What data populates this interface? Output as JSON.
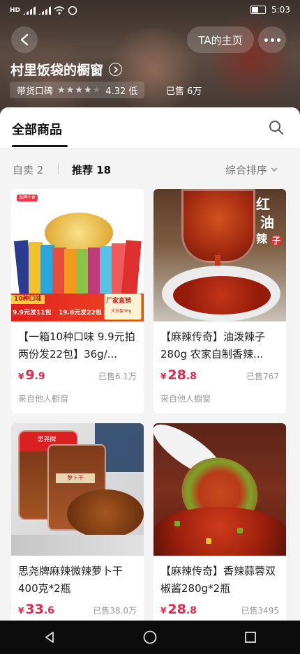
{
  "status_bar": {
    "time": "5:03"
  },
  "header": {
    "back_icon": "chevron-left-icon",
    "ta_home_label": "TA的主页",
    "more_icon": "more-dots-icon",
    "shop_name": "村里饭袋的橱窗",
    "rating_label": "带货口碑",
    "rating_stars": 4,
    "rating_value": "4.32 低",
    "sold_total": "已售 6万"
  },
  "tabs": {
    "all_products": "全部商品"
  },
  "filters": {
    "self_sell": "自卖 2",
    "recommended": "推荐 18",
    "sort": "综合排序"
  },
  "products": [
    {
      "name": "【一箱10种口味 9.9元拍两份发22包】36g/...",
      "price_symbol": "¥",
      "price_int": "9",
      "price_dec": ".9",
      "sold": "已售6.1万",
      "source": "来自他人橱窗",
      "img_texts": {
        "badge_left": "10种口味",
        "line1": "9.9元发11包",
        "line2": "19.8元发22包",
        "badge_right": "厂家直销",
        "weight": "大份装36g",
        "brand": "品牌小食"
      }
    },
    {
      "name": "【麻辣传奇】油泼辣子280g 农家自制香辣...",
      "price_symbol": "¥",
      "price_int": "28",
      "price_dec": ".8",
      "sold": "已售767",
      "source": "来自他人橱窗",
      "img_texts": {
        "v1": "红",
        "v2": "油",
        "v3": "辣",
        "v4": "子"
      }
    },
    {
      "name": "思尧牌麻辣微辣萝卜干400克*2瓶",
      "price_symbol": "¥",
      "price_int": "33",
      "price_dec": ".6",
      "sold": "已售38.0万",
      "source": "",
      "img_texts": {
        "jar_label": "思尧牌",
        "jar_label2": "萝卜干"
      }
    },
    {
      "name": "【麻辣传奇】香辣蒜蓉双椒酱280g*2瓶",
      "price_symbol": "¥",
      "price_int": "28",
      "price_dec": ".8",
      "sold": "已售3495",
      "source": ""
    }
  ],
  "nav": {
    "back_icon": "triangle-back-icon",
    "home_icon": "circle-home-icon",
    "recent_icon": "square-recents-icon"
  }
}
